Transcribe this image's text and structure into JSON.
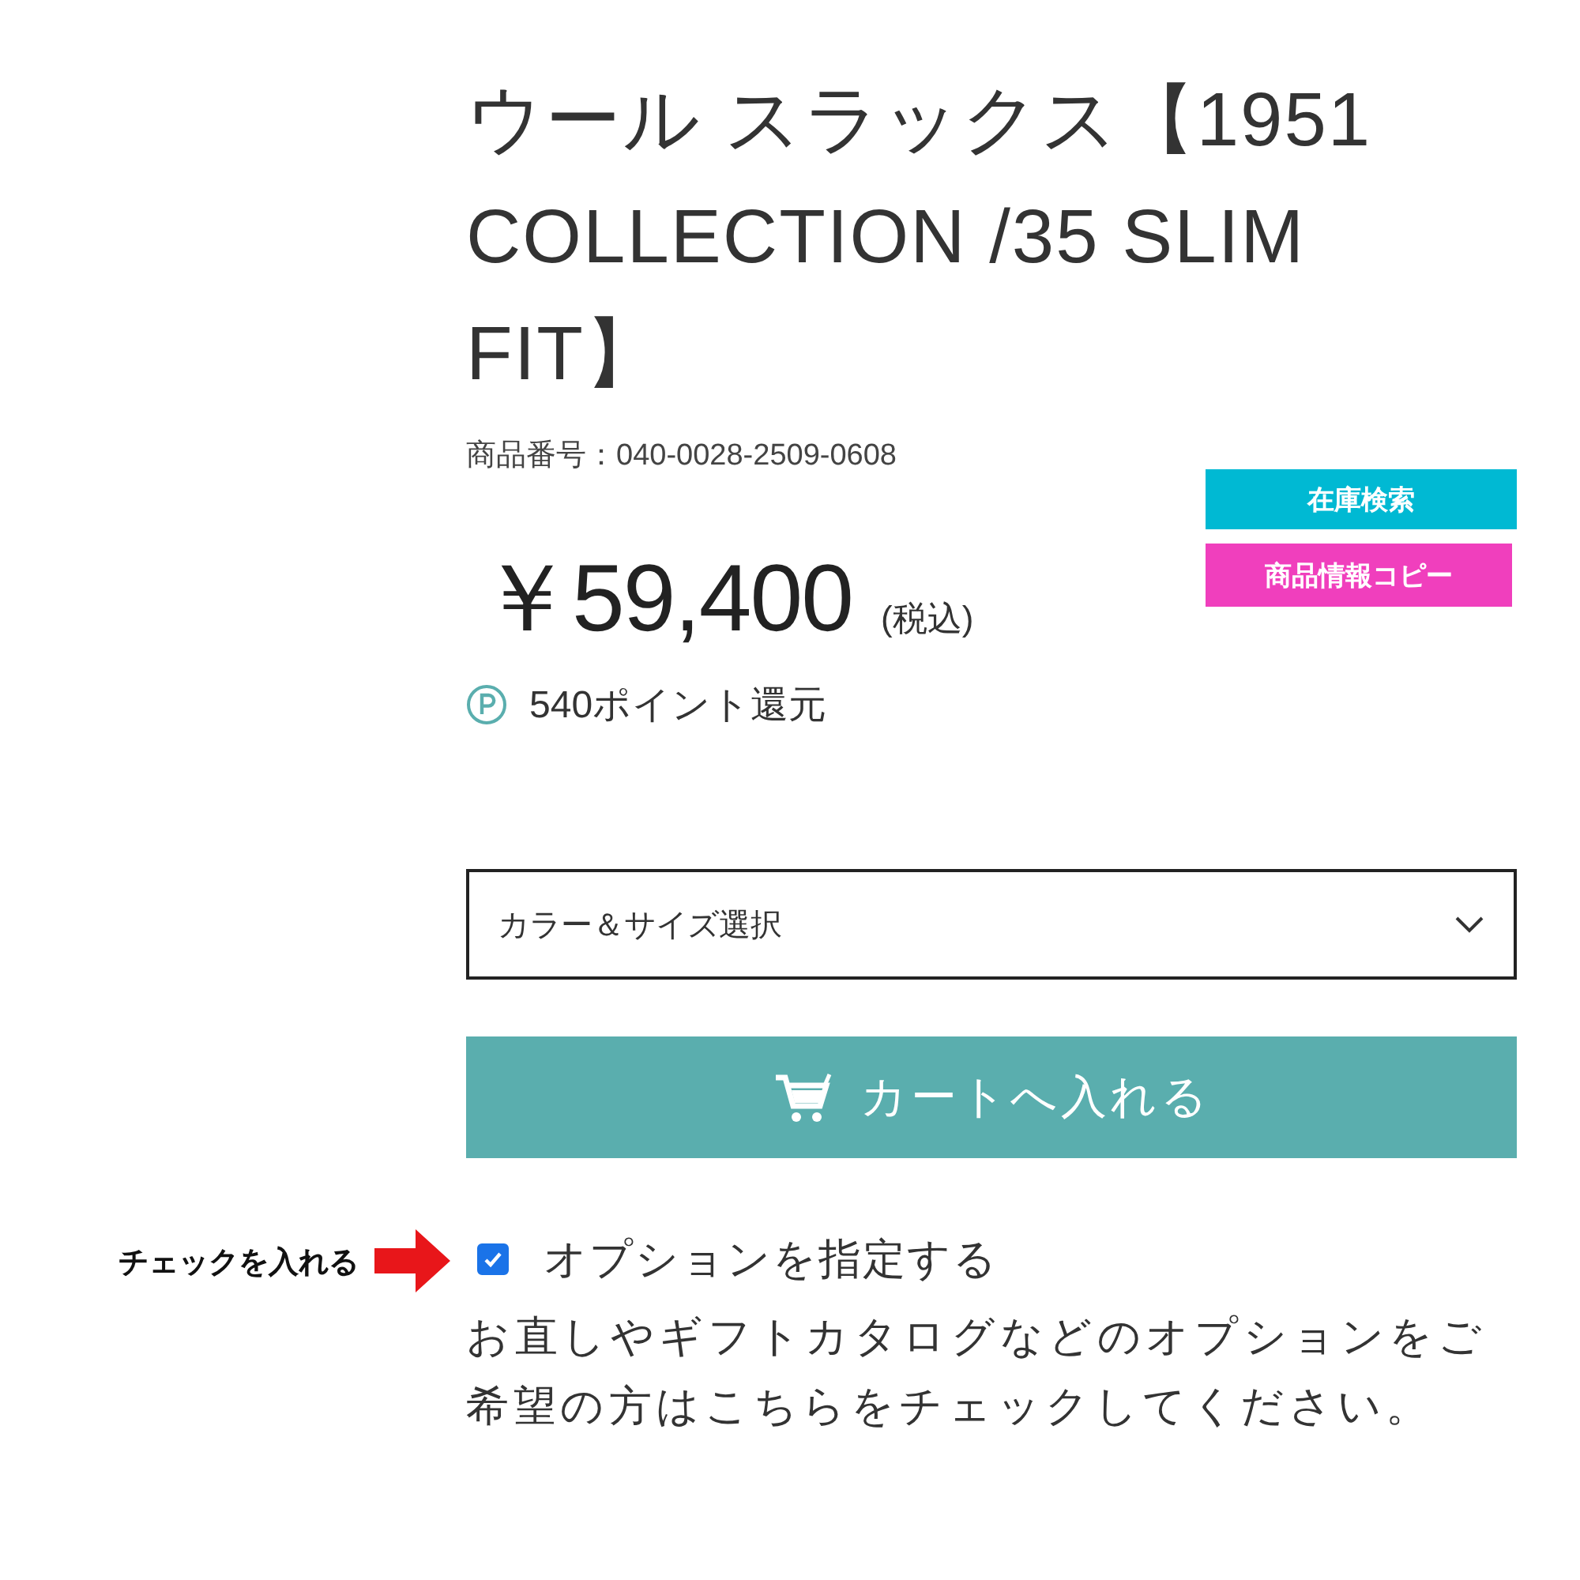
{
  "product": {
    "title": "ウール スラックス【1951 COLLECTION /35 SLIM FIT】",
    "number_label": "商品番号：040-0028-2509-0608",
    "price": "￥59,400",
    "tax_note": "(税込)",
    "points": "540ポイント還元"
  },
  "side_buttons": [
    {
      "label": "在庫検索",
      "color": "#00b9d3"
    },
    {
      "label": "商品情報コピー",
      "color": "#f03fbd"
    }
  ],
  "variant_select": {
    "placeholder": "カラー＆サイズ選択"
  },
  "cart_button": {
    "label": "カートへ入れる"
  },
  "annotation": {
    "label": "チェックを入れる"
  },
  "option": {
    "label": "オプションを指定する",
    "checked": true,
    "description": "お直しやギフトカタログなどのオプションをご希望の方はこちらをチェックしてください。"
  }
}
